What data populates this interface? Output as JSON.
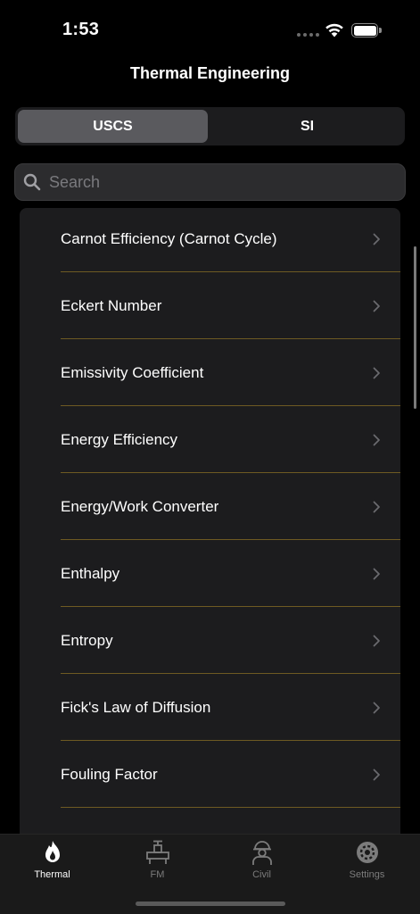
{
  "status_bar": {
    "time": "1:53"
  },
  "nav": {
    "title": "Thermal Engineering"
  },
  "units": {
    "options": [
      "USCS",
      "SI"
    ],
    "selected": "USCS"
  },
  "search": {
    "placeholder": "Search",
    "value": ""
  },
  "list": {
    "items": [
      {
        "label": "Carnot Efficiency (Carnot Cycle)"
      },
      {
        "label": "Eckert Number"
      },
      {
        "label": "Emissivity Coefficient"
      },
      {
        "label": "Energy Efficiency"
      },
      {
        "label": "Energy/Work Converter"
      },
      {
        "label": "Enthalpy"
      },
      {
        "label": "Entropy"
      },
      {
        "label": "Fick's Law of Diffusion"
      },
      {
        "label": "Fouling Factor"
      },
      {
        "label": ""
      }
    ]
  },
  "tabs": [
    {
      "label": "Thermal",
      "icon": "flame-icon",
      "active": true
    },
    {
      "label": "FM",
      "icon": "pipe-valve-icon",
      "active": false
    },
    {
      "label": "Civil",
      "icon": "worker-icon",
      "active": false
    },
    {
      "label": "Settings",
      "icon": "gear-icon",
      "active": false
    }
  ],
  "colors": {
    "background": "#000000",
    "cell": "#1c1c1e",
    "divider": "#6e5a23",
    "segment_selected": "#5a5a5e",
    "tab_inactive": "#7c7c7c"
  }
}
